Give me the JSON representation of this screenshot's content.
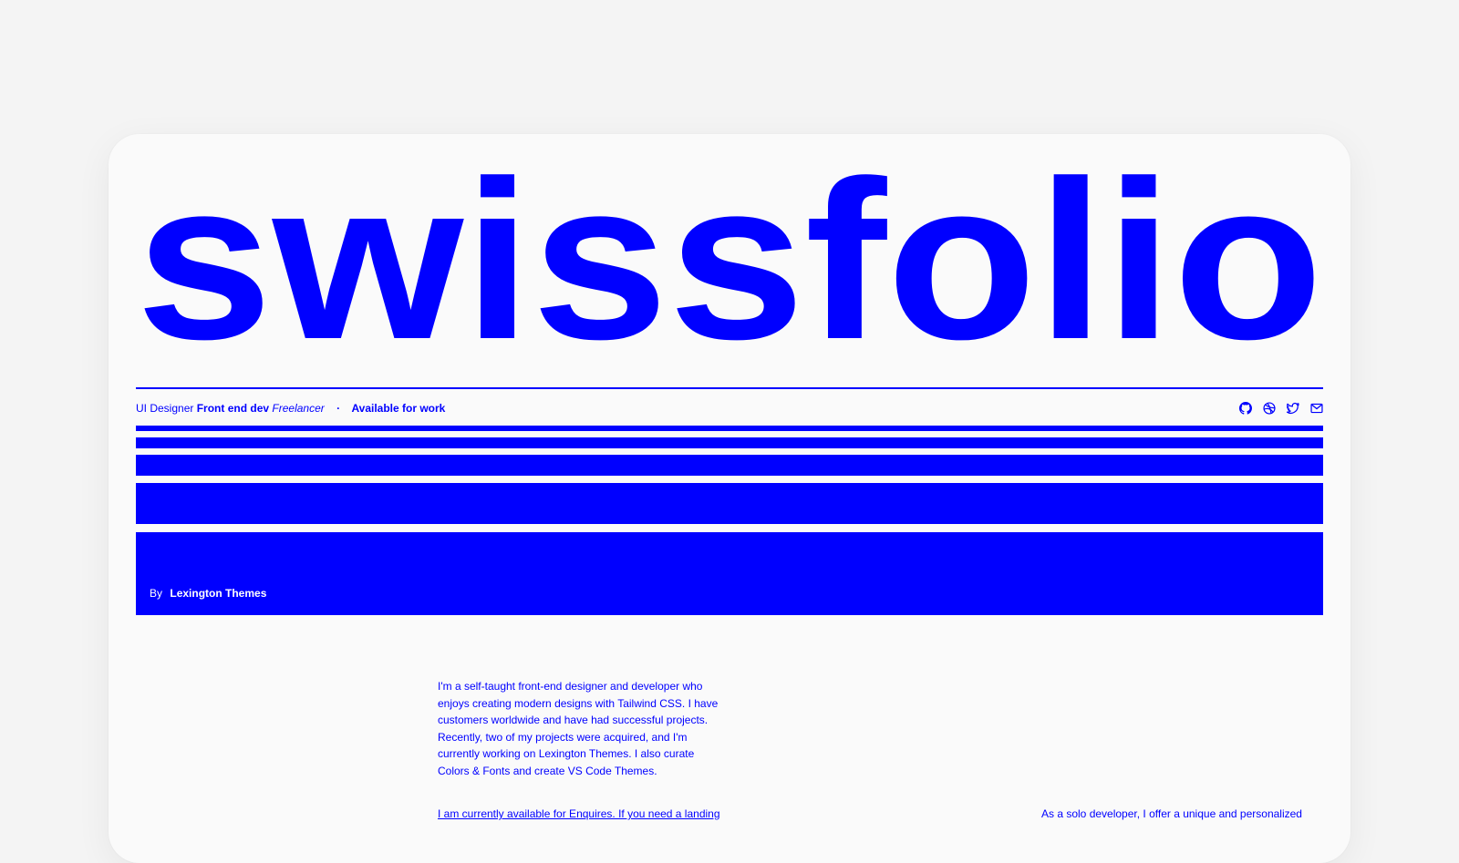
{
  "brand": {
    "wordmark": "swissfolio",
    "color": "#0000ff"
  },
  "meta": {
    "role_1": "UI Designer",
    "role_2": "Front end dev",
    "role_3": "Freelancer",
    "separator": "·",
    "availability": "Available for work"
  },
  "socials": [
    {
      "icon": "github-icon"
    },
    {
      "icon": "dribbble-icon"
    },
    {
      "icon": "twitter-icon"
    },
    {
      "icon": "mail-icon"
    }
  ],
  "hero": {
    "by_label": "By",
    "author": "Lexington Themes"
  },
  "intro": {
    "text": "I'm a self-taught front-end designer and developer who enjoys creating modern designs with Tailwind CSS. I have customers worldwide and have had successful projects. Recently, two of my projects were acquired, and I'm currently working on Lexington Themes. I also curate Colors & Fonts and create VS Code Themes.",
    "cta": "I am currently available for Enquires. If you need a landing"
  },
  "services": {
    "text": "As a solo developer, I offer a unique and personalized"
  }
}
